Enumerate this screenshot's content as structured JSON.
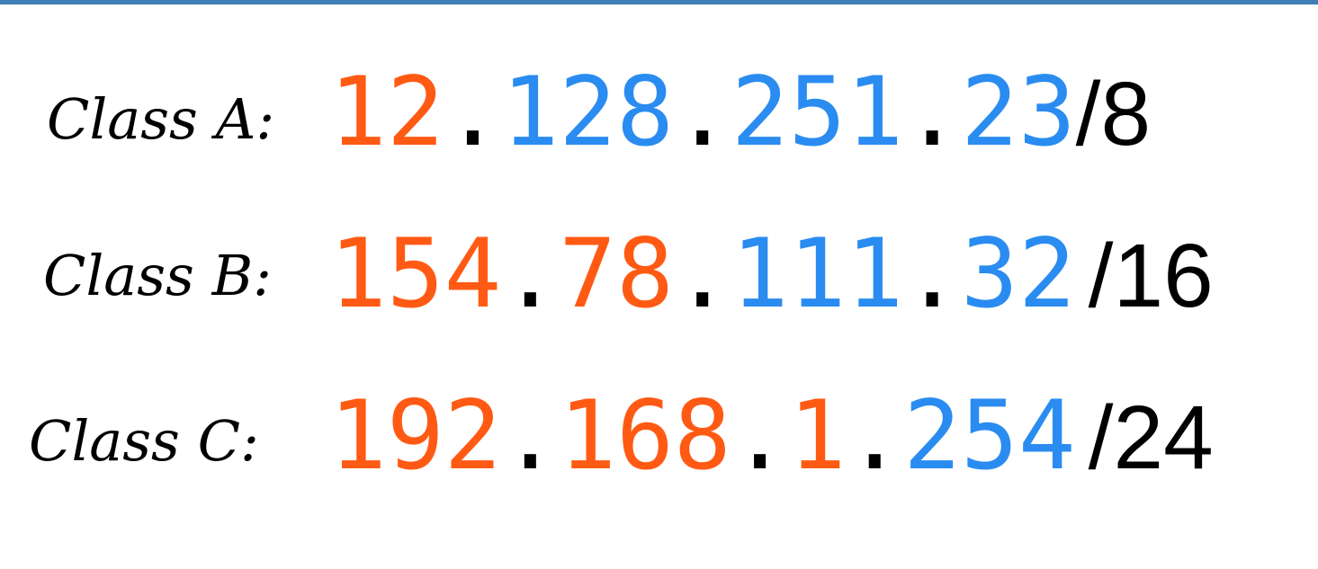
{
  "colors": {
    "network": "#ff5a14",
    "host": "#2a8cf0",
    "separator": "#000000",
    "top_bar": "#3f7fb5"
  },
  "rows": [
    {
      "label": "Class A:",
      "octets": [
        {
          "value": "12",
          "part": "network"
        },
        {
          "value": "128",
          "part": "host"
        },
        {
          "value": "251",
          "part": "host"
        },
        {
          "value": "23",
          "part": "host"
        }
      ],
      "mask": "/8"
    },
    {
      "label": "Class B:",
      "octets": [
        {
          "value": "154",
          "part": "network"
        },
        {
          "value": "78",
          "part": "network"
        },
        {
          "value": "111",
          "part": "host"
        },
        {
          "value": "32",
          "part": "host"
        }
      ],
      "mask": "/16"
    },
    {
      "label": "Class C:",
      "octets": [
        {
          "value": "192",
          "part": "network"
        },
        {
          "value": "168",
          "part": "network"
        },
        {
          "value": "1",
          "part": "network"
        },
        {
          "value": "254",
          "part": "host"
        }
      ],
      "mask": "/24"
    }
  ]
}
